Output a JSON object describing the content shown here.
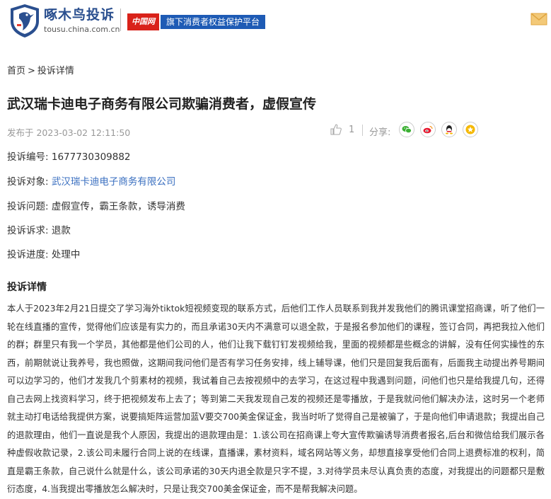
{
  "header": {
    "logo_title": "啄木鸟投诉",
    "logo_domain": "tousu.china.com.cn",
    "partner_badge": "中国网",
    "partner_slogan": "旗下消费者权益保护平台"
  },
  "breadcrumb": {
    "home": "首页",
    "separator": ">",
    "current": "投诉详情"
  },
  "article": {
    "title": "武汉瑞卡迪电子商务有限公司欺骗消费者，虚假宣传",
    "published": "发布于 2023-03-02 12:11:50",
    "like_count": "1",
    "share_label": "分享:"
  },
  "share_icons": [
    "wechat-icon",
    "weibo-icon",
    "qq-icon",
    "favorite-icon"
  ],
  "fields": {
    "id_label": "投诉编号:",
    "id_value": "1677730309882",
    "target_label": "投诉对象:",
    "target_value": "武汉瑞卡迪电子商务有限公司",
    "issue_label": "投诉问题:",
    "issue_value": "虚假宣传，霸王条款，诱导消费",
    "demand_label": "投诉诉求:",
    "demand_value": "退款",
    "progress_label": "投诉进度:",
    "progress_value": "处理中"
  },
  "detail": {
    "heading": "投诉详情",
    "body": "本人于2023年2月21日提交了学习海外tiktok短视频变现的联系方式，后他们工作人员联系到我并发我他们的腾讯课堂招商课，听了他们一轮在线直播的宣传，觉得他们应该是有实力的，而且承诺30天内不满意可以退全款，于是报名参加他们的课程，签订合同，再把我拉入他们的群；群里只有我一个学员，其他都是他们公司的人，他们让我下载钉钉发视频给我，里面的视频都是些概念的讲解，没有任何实操性的东西，前期就说让我养号，我也照做，这期间我问他们是否有学习任务安排，线上辅导课，他们只是回复我后面有，后面我主动提出养号期间可以边学习的，他们才发我几个剪素材的视频，我试着自己去按视频中的去学习，在这过程中我遇到问题，问他们也只是给我提几句，还得自己去网上找资料学习，终于把视频发布上去了；等到第二天我发现自己发的视频还是零播放，于是我就问他们解决办法，这时另一个老师就主动打电话给我提供方案，说要搞矩阵运营加蓝V要交700美金保证金，我当时听了觉得自己是被骗了，于是向他们申请退款；我提出自己的退款理由，他们一直说是我个人原因，我提出的退款理由是：1.该公司在招商课上夸大宣传欺骗诱导消费者报名,后台和微信给我们展示各种虚假收款记录，2.该公司未履行合同上说的在线课，直播课，素材资料，域名网站等义务，却想直接享受他们合同上退费标准的权利，简直是霸王条款，自己说什么就是什么，该公司承诺的30天内退全款是只字不提，3.对待学员未尽认真负责的态度，对我提出的问题都只是敷衍态度，4.当我提出零播放怎么解决时，只是让我交700美金保证金，而不是帮我解决问题。"
  },
  "colors": {
    "brand_blue": "#2a4f8f",
    "link_blue": "#3a6fc0",
    "partner_red": "#d9221a",
    "wechat_green": "#3cb034",
    "weibo_red": "#e6162d",
    "favorite_yellow": "#f5b800"
  }
}
